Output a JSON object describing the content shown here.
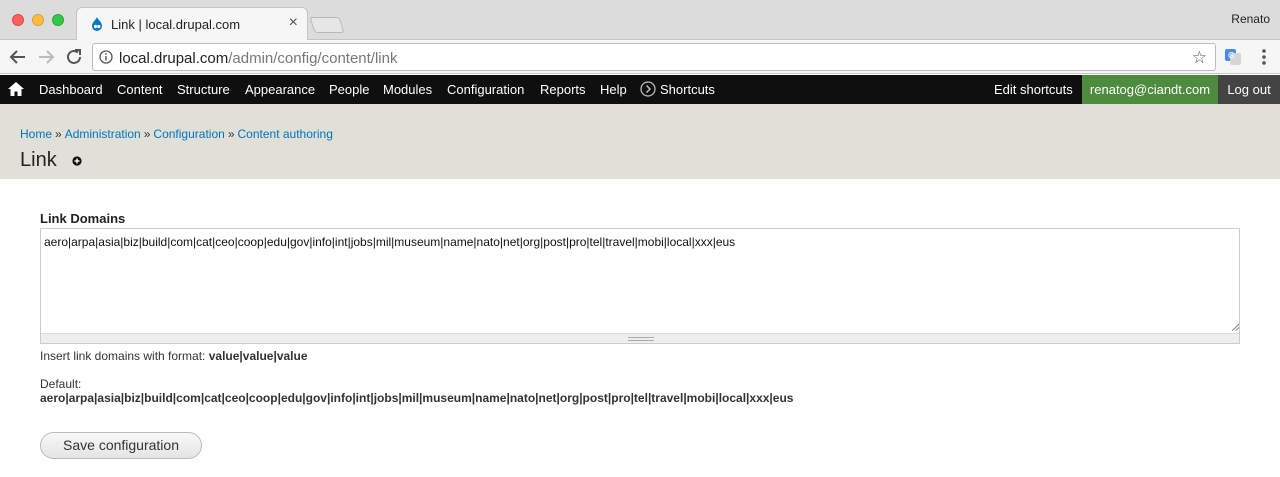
{
  "browser": {
    "tab_title": "Link | local.drupal.com",
    "profile_name": "Renato",
    "url_host": "local.drupal.com",
    "url_path": "/admin/config/content/link"
  },
  "admin_toolbar": {
    "items": [
      "Dashboard",
      "Content",
      "Structure",
      "Appearance",
      "People",
      "Modules",
      "Configuration",
      "Reports",
      "Help",
      "Shortcuts"
    ],
    "edit_shortcuts": "Edit shortcuts",
    "user": "renatog@ciandt.com",
    "logout": "Log out"
  },
  "breadcrumb": {
    "items": [
      "Home",
      "Administration",
      "Configuration",
      "Content authoring"
    ],
    "separator": "»"
  },
  "page": {
    "title": "Link"
  },
  "form": {
    "label": "Link Domains",
    "value": "aero|arpa|asia|biz|build|com|cat|ceo|coop|edu|gov|info|int|jobs|mil|museum|name|nato|net|org|post|pro|tel|travel|mobi|local|xxx|eus",
    "description_prefix": "Insert link domains with format: ",
    "description_format": "value|value|value",
    "default_label": "Default:",
    "default_value": "aero|arpa|asia|biz|build|com|cat|ceo|coop|edu|gov|info|int|jobs|mil|museum|name|nato|net|org|post|pro|tel|travel|mobi|local|xxx|eus",
    "save_label": "Save configuration"
  },
  "colors": {
    "toolbar_bg": "#0f0f0f",
    "user_bg": "#4d8b3f",
    "logout_bg": "#444444",
    "header_bg": "#e0e0d8",
    "link": "#0074bd"
  },
  "icons": {
    "favicon": "drupal-drop-icon",
    "home": "home-icon",
    "shortcuts": "chevron-circle-icon",
    "add_shortcut": "plus-circle-icon"
  }
}
